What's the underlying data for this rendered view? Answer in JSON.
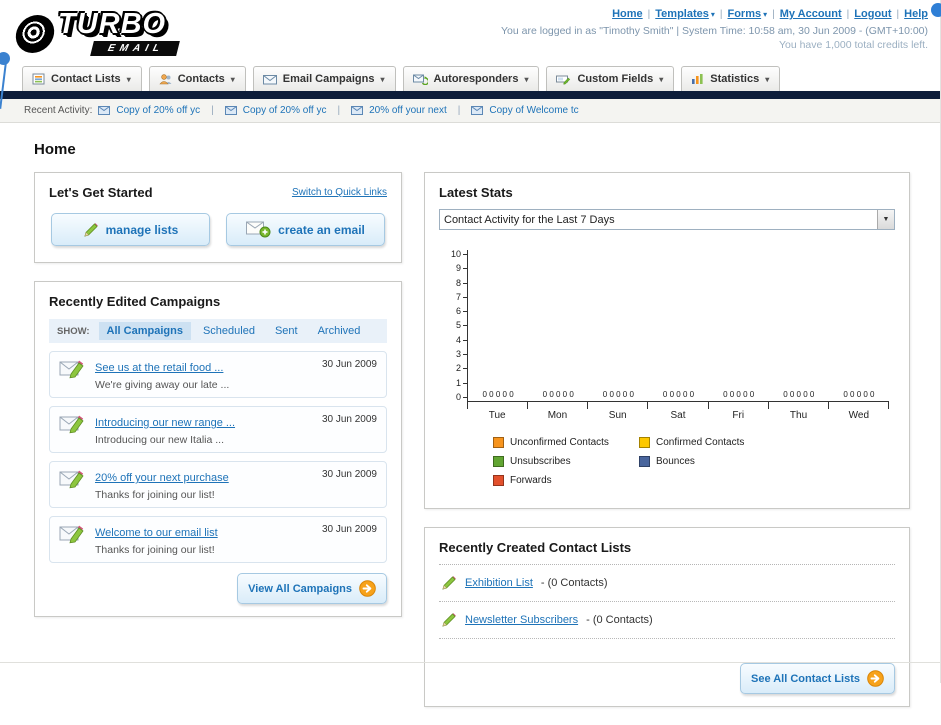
{
  "header": {
    "logo_title": "TURBO",
    "logo_subtitle": "EMAIL",
    "links": [
      {
        "label": "Home",
        "has_menu": false
      },
      {
        "label": "Templates",
        "has_menu": true
      },
      {
        "label": "Forms",
        "has_menu": true
      },
      {
        "label": "My Account",
        "has_menu": false
      },
      {
        "label": "Logout",
        "has_menu": false
      },
      {
        "label": "Help",
        "has_menu": false
      }
    ],
    "login_info": "You are logged in as \"Timothy Smith\" | System Time: 10:58 am, 30 Jun 2009 - (GMT+10:00)",
    "credits_info": "You have 1,000 total credits left."
  },
  "nav_tabs": [
    {
      "label": "Contact Lists",
      "icon": "contact-lists-icon"
    },
    {
      "label": "Contacts",
      "icon": "contacts-icon"
    },
    {
      "label": "Email Campaigns",
      "icon": "email-campaigns-icon"
    },
    {
      "label": "Autoresponders",
      "icon": "autoresponders-icon"
    },
    {
      "label": "Custom Fields",
      "icon": "custom-fields-icon"
    },
    {
      "label": "Statistics",
      "icon": "statistics-icon"
    }
  ],
  "recent_activity": {
    "label": "Recent Activity:",
    "items": [
      {
        "label": "Copy of 20% off yc",
        "icon": "envelope-icon"
      },
      {
        "label": "Copy of 20% off yc",
        "icon": "envelope-icon"
      },
      {
        "label": "20% off your next",
        "icon": "envelope-icon"
      },
      {
        "label": "Copy of Welcome tc",
        "icon": "envelope-icon"
      }
    ]
  },
  "page_title": "Home",
  "get_started": {
    "title": "Let's Get Started",
    "switch_link": "Switch to Quick Links",
    "manage_lists_label": "manage lists",
    "create_email_label": "create an email"
  },
  "campaigns": {
    "title": "Recently Edited Campaigns",
    "show_label": "SHOW:",
    "filters": [
      {
        "label": "All Campaigns",
        "selected": true
      },
      {
        "label": "Scheduled",
        "selected": false
      },
      {
        "label": "Sent",
        "selected": false
      },
      {
        "label": "Archived",
        "selected": false
      }
    ],
    "items": [
      {
        "title": "See us at the retail food ...",
        "subtitle": "We're giving away our late ...",
        "date": "30 Jun 2009"
      },
      {
        "title": "Introducing our new range ...",
        "subtitle": "Introducing our new Italia ...",
        "date": "30 Jun 2009"
      },
      {
        "title": "20% off your next purchase",
        "subtitle": "Thanks for joining our list!",
        "date": "30 Jun 2009"
      },
      {
        "title": "Welcome to our email list",
        "subtitle": "Thanks for joining our list!",
        "date": "30 Jun 2009"
      }
    ],
    "view_all_label": "View All Campaigns"
  },
  "stats": {
    "title": "Latest Stats",
    "selector_value": "Contact Activity for the Last 7 Days"
  },
  "chart_data": {
    "type": "bar",
    "title": "Contact Activity for the Last 7 Days",
    "categories": [
      "Tue",
      "Mon",
      "Sun",
      "Sat",
      "Fri",
      "Thu",
      "Wed"
    ],
    "series": [
      {
        "name": "Unconfirmed Contacts",
        "color": "#f7941d",
        "values": [
          0,
          0,
          0,
          0,
          0,
          0,
          0
        ]
      },
      {
        "name": "Confirmed Contacts",
        "color": "#fdc800",
        "values": [
          0,
          0,
          0,
          0,
          0,
          0,
          0
        ]
      },
      {
        "name": "Unsubscribes",
        "color": "#61a532",
        "values": [
          0,
          0,
          0,
          0,
          0,
          0,
          0
        ]
      },
      {
        "name": "Bounces",
        "color": "#49659d",
        "values": [
          0,
          0,
          0,
          0,
          0,
          0,
          0
        ]
      },
      {
        "name": "Forwards",
        "color": "#e2502c",
        "values": [
          0,
          0,
          0,
          0,
          0,
          0,
          0
        ]
      }
    ],
    "ylim": [
      0,
      10
    ],
    "ytick_step": 1,
    "grid": false,
    "legend_position": "bottom",
    "bar_value_labels_shown": true
  },
  "contact_lists": {
    "title": "Recently Created Contact Lists",
    "items": [
      {
        "name": "Exhibition List",
        "suffix": " - (0 Contacts)"
      },
      {
        "name": "Newsletter Subscribers",
        "suffix": " - (0 Contacts)"
      }
    ],
    "see_all_label": "See All Contact Lists"
  }
}
